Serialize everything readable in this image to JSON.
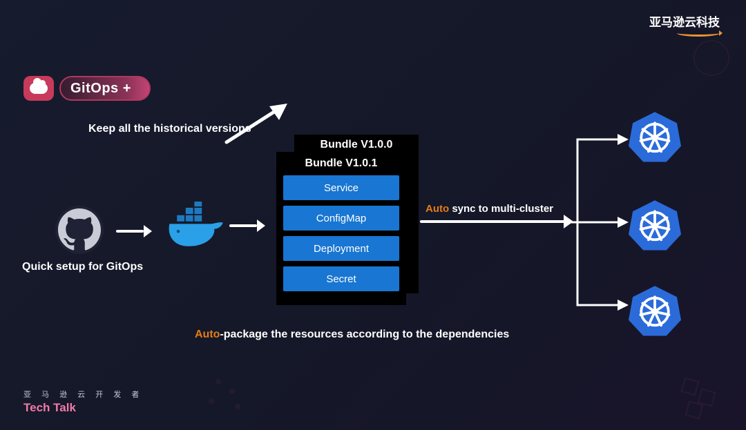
{
  "brand": {
    "aws_cn": "亚马逊云科技"
  },
  "title": "GitOps +",
  "labels": {
    "quick_setup": "Quick setup for GitOps",
    "historical": "Keep all the historical versions",
    "auto_sync_prefix": "Auto",
    "auto_sync_rest": " sync to multi-cluster",
    "auto_pkg_prefix": "Auto",
    "auto_pkg_rest": "-package the resources according to the dependencies"
  },
  "bundles": {
    "back_title": "Bundle V1.0.0",
    "front_title": "Bundle V1.0.1",
    "resources": [
      "Service",
      "ConfigMap",
      "Deployment",
      "Secret"
    ]
  },
  "footer": {
    "line1": "亚 马 逊 云 开 发 者",
    "line2": "Tech Talk"
  },
  "icons": {
    "title_badge": "cloud-icon",
    "github": "github-icon",
    "docker": "docker-icon",
    "k8s": "kubernetes-icon"
  },
  "colors": {
    "accent_blue": "#1976d2",
    "accent_orange": "#e67b18",
    "brand_pink": "#c73a5c",
    "k8s_blue": "#2a6bd9"
  }
}
